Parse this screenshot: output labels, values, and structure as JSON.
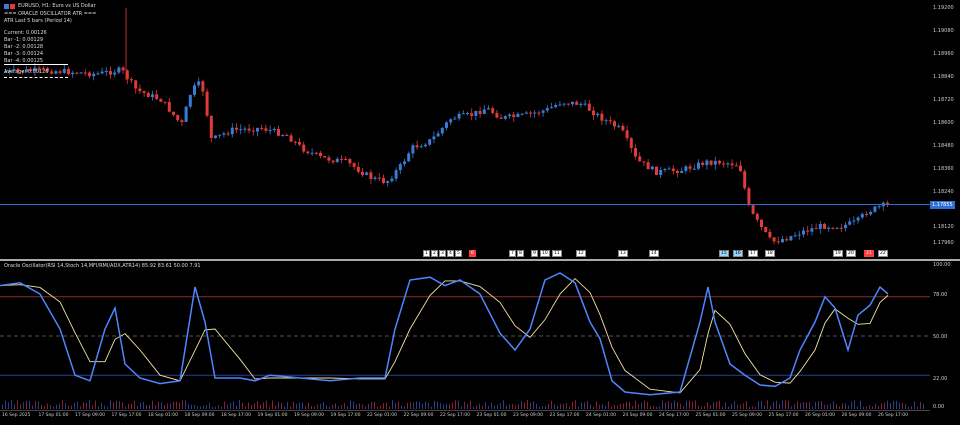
{
  "window": {
    "symbol_title": "EURUSD, H1: Euro vs US Dollar",
    "indicator_title": "=== ORACLE OSCILLATOR ATR ===",
    "atr_settings": "ATR Last 5 bars (Period 14)"
  },
  "atr_panel": {
    "current": "Current: 0.00126",
    "bars": [
      "Bar -1: 0.00129",
      "Bar -2: 0.00128",
      "Bar -3: 0.00124",
      "Bar -4: 0.00125"
    ],
    "average": "Average: 0.00126"
  },
  "price_axis": {
    "labels": [
      "1.19200",
      "1.19080",
      "1.18960",
      "1.18840",
      "1.18720",
      "1.18600",
      "1.18480",
      "1.18360",
      "1.18240",
      "1.18120",
      "1.17960"
    ],
    "current_price": "1.17855"
  },
  "osc_panel": {
    "title": "Oracle Oscillator(RSI 14,Stoch 14,MFI/RMI/ADX,ATR14) 85.92 83.61 50.00 7.91",
    "levels": [
      "100.00",
      "78.00",
      "50.00",
      "22.00",
      "0.00"
    ]
  },
  "time_axis": [
    "16 Sep 2025",
    "17 Sep 01:00",
    "17 Sep 09:00",
    "17 Sep 17:00",
    "18 Sep 01:00",
    "18 Sep 09:00",
    "18 Sep 17:00",
    "19 Sep 01:00",
    "19 Sep 09:00",
    "19 Sep 17:00",
    "22 Sep 01:00",
    "22 Sep 09:00",
    "22 Sep 17:00",
    "23 Sep 01:00",
    "23 Sep 09:00",
    "23 Sep 17:00",
    "24 Sep 01:00",
    "24 Sep 09:00",
    "24 Sep 17:00",
    "25 Sep 01:00",
    "25 Sep 09:00",
    "25 Sep 17:00",
    "26 Sep 01:00",
    "26 Sep 09:00",
    "26 Sep 17:00"
  ],
  "colors": {
    "bull": "#3a7bd5",
    "bear": "#e03a3a",
    "osc_line": "#4f86ff",
    "signal_line": "#f4e3a0",
    "level_red": "#8b2a2a",
    "level_blue": "#2a3f8b"
  }
}
